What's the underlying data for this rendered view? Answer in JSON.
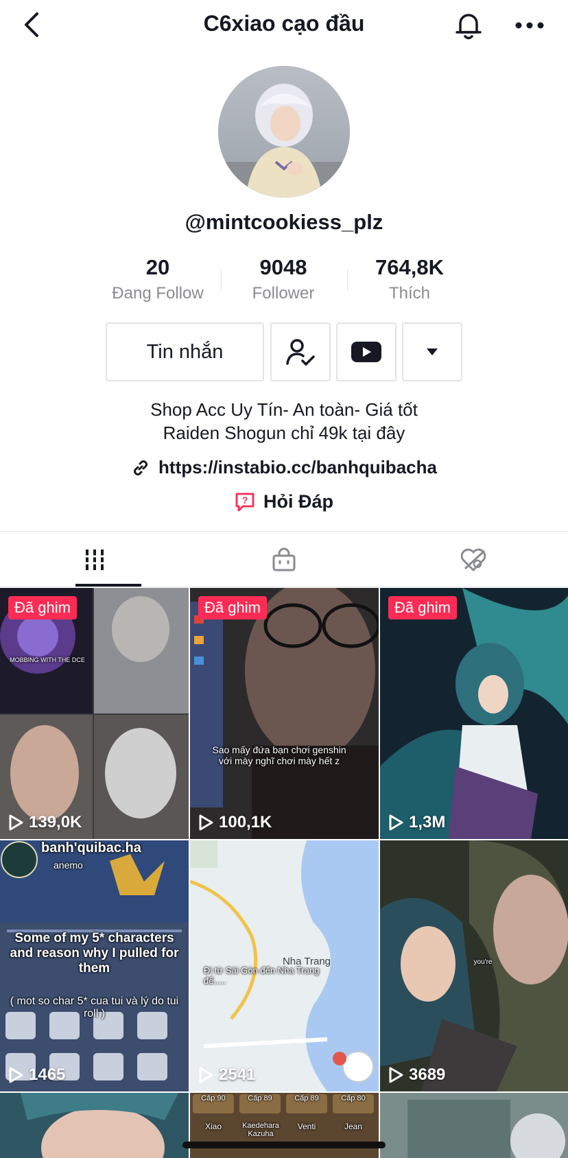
{
  "header": {
    "title": "C6xiao cạo đầu",
    "back_icon": "chevron-left-icon",
    "bell_icon": "bell-icon",
    "more_icon": "more-horizontal-icon"
  },
  "profile": {
    "username": "@mintcookiess_plz",
    "stats": [
      {
        "value": "20",
        "label": "Đang Follow"
      },
      {
        "value": "9048",
        "label": "Follower"
      },
      {
        "value": "764,8K",
        "label": "Thích"
      }
    ],
    "message_button": "Tin nhắn",
    "bio_line1": "Shop Acc Uy Tín- An toàn- Giá tốt",
    "bio_line2": "Raiden Shogun chỉ 49k tại đây",
    "link": "https://instabio.cc/banhquibacha",
    "qa_label": "Hỏi Đáp"
  },
  "tabs": [
    {
      "icon": "grid-icon",
      "active": true
    },
    {
      "icon": "shopping-bag-icon",
      "active": false
    },
    {
      "icon": "heart-hidden-icon",
      "active": false
    }
  ],
  "videos": [
    {
      "pinned": "Đã ghim",
      "views": "139,0K",
      "overlay": "MOBBING WITH THE DCE"
    },
    {
      "pinned": "Đã ghim",
      "views": "100,1K",
      "overlay": "Sao mấy đứa bạn chơi genshin với mày nghĩ chơi mày hết z"
    },
    {
      "pinned": "Đã ghim",
      "views": "1,3M"
    },
    {
      "views": "1465",
      "title": "banh'quibac.ha",
      "subtitle": "anemo",
      "overlay": "Some of my 5* characters and reason why I pulled for them",
      "overlay2": "( mot so char 5* cua tui và lý do tui roll )"
    },
    {
      "views": "2541",
      "overlay": "Đi từ Sài Gòn đến Nha Trang để.....",
      "map_city": "Nha Trang"
    },
    {
      "views": "3689",
      "overlay": "you're"
    },
    {},
    {
      "names": [
        "Xiao",
        "Kaedehara Kazuha",
        "Venti",
        "Jean"
      ],
      "levels": [
        "Cấp 90",
        "Cấp 89",
        "Cấp 89",
        "Cấp 80"
      ]
    },
    {}
  ],
  "colors": {
    "accent": "#fe2c55",
    "text": "#161823",
    "muted": "#8a8b91",
    "border": "#e3e3e4"
  }
}
